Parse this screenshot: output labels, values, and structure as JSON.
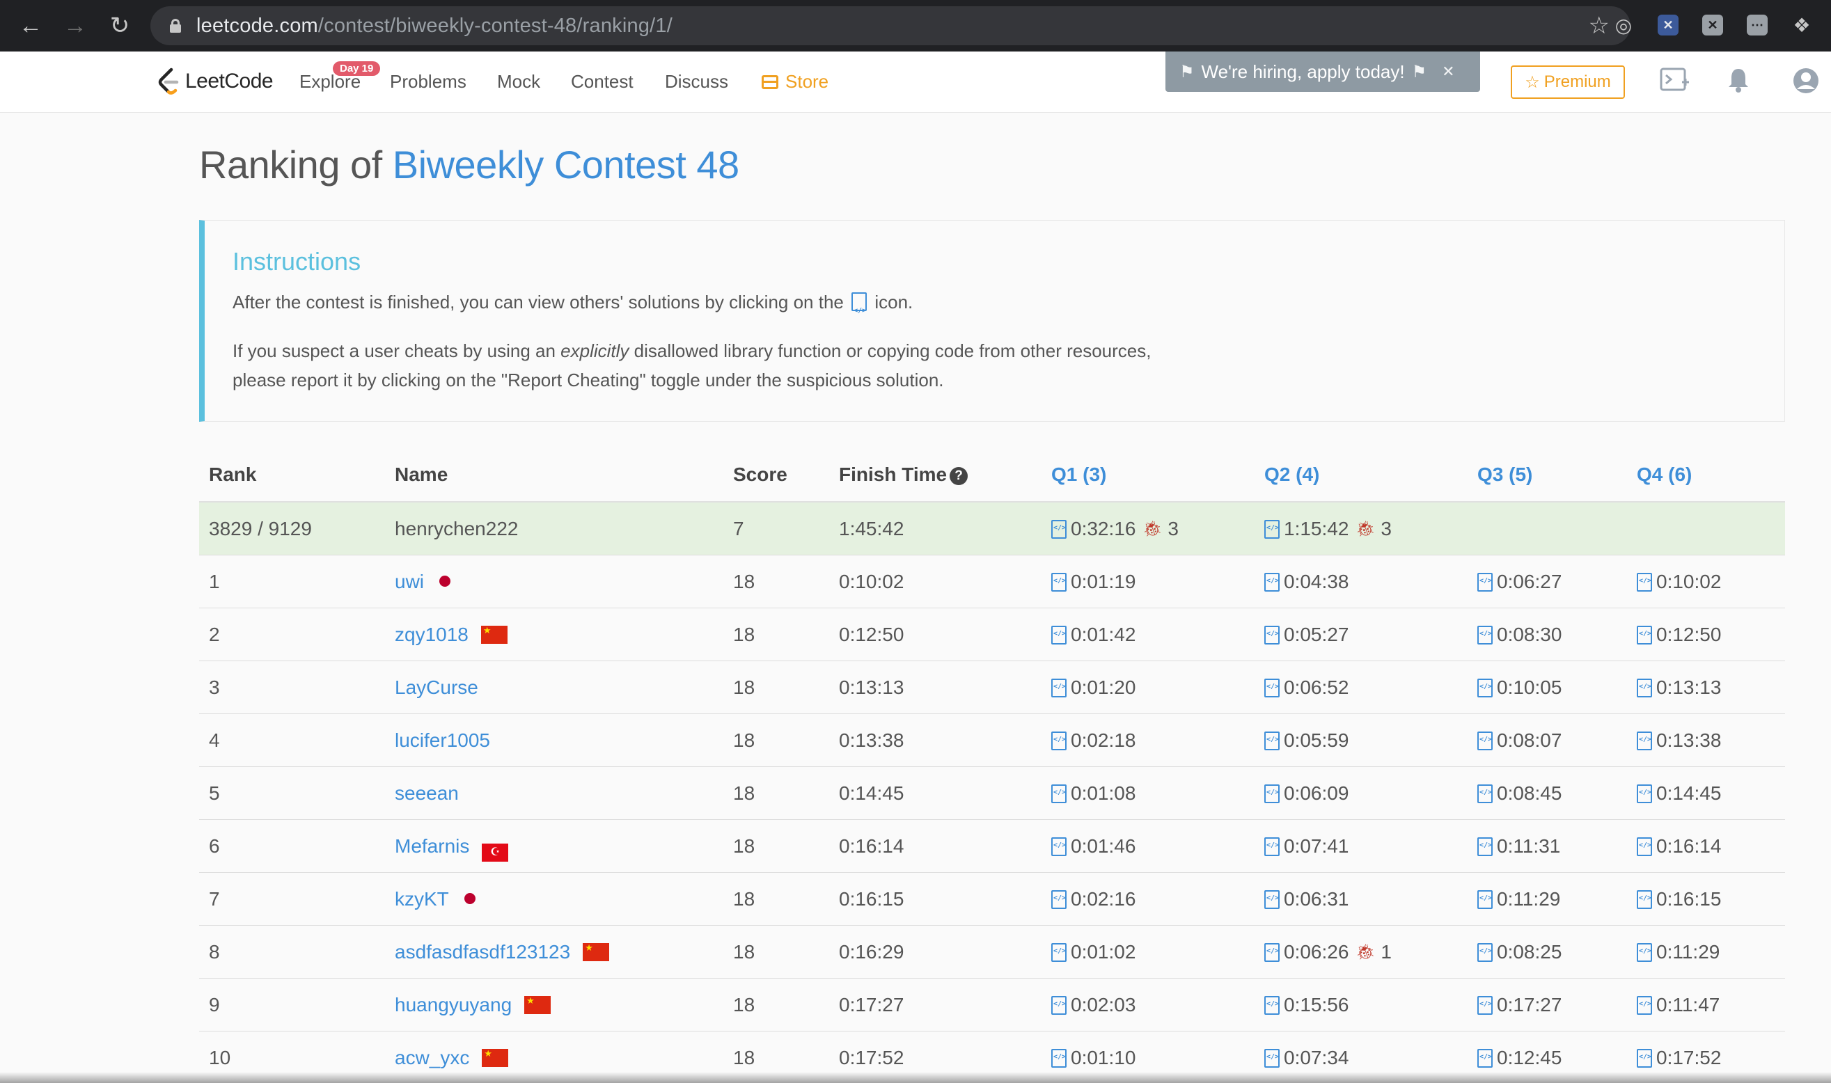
{
  "browser": {
    "url_host": "leetcode.com",
    "url_path": "/contest/biweekly-contest-48/ranking/1/"
  },
  "nav": {
    "logo_text": "LeetCode",
    "explore": "Explore",
    "explore_badge": "Day 19",
    "problems": "Problems",
    "mock": "Mock",
    "contest": "Contest",
    "discuss": "Discuss",
    "store": "Store",
    "hiring": "We're hiring, apply today!",
    "premium": "Premium"
  },
  "page": {
    "title_prefix": "Ranking of",
    "title_link": "Biweekly Contest 48"
  },
  "instructions": {
    "heading": "Instructions",
    "line1_before": "After the contest is finished, you can view others' solutions by clicking on the",
    "line1_after": "icon.",
    "line2_a": "If you suspect a user cheats by using an",
    "line2_em": "explicitly",
    "line2_b": "disallowed library function or copying code from other resources,",
    "line3": "please report it by clicking on the \"Report Cheating\" toggle under the suspicious solution."
  },
  "table": {
    "headers": {
      "rank": "Rank",
      "name": "Name",
      "score": "Score",
      "finish": "Finish Time",
      "q1": "Q1 (3)",
      "q2": "Q2 (4)",
      "q3": "Q3 (5)",
      "q4": "Q4 (6)"
    },
    "my_row": {
      "rank": "3829 / 9129",
      "name": "henrychen222",
      "score": "7",
      "finish": "1:45:42",
      "q1": "0:32:16",
      "q1_bugs": "3",
      "q2": "1:15:42",
      "q2_bugs": "3"
    },
    "rows": [
      {
        "rank": "1",
        "name": "uwi",
        "flag": "jp",
        "score": "18",
        "finish": "0:10:02",
        "q1": "0:01:19",
        "q2": "0:04:38",
        "q3": "0:06:27",
        "q4": "0:10:02"
      },
      {
        "rank": "2",
        "name": "zqy1018",
        "flag": "cn",
        "score": "18",
        "finish": "0:12:50",
        "q1": "0:01:42",
        "q2": "0:05:27",
        "q3": "0:08:30",
        "q4": "0:12:50"
      },
      {
        "rank": "3",
        "name": "LayCurse",
        "flag": "",
        "score": "18",
        "finish": "0:13:13",
        "q1": "0:01:20",
        "q2": "0:06:52",
        "q3": "0:10:05",
        "q4": "0:13:13"
      },
      {
        "rank": "4",
        "name": "lucifer1005",
        "flag": "",
        "score": "18",
        "finish": "0:13:38",
        "q1": "0:02:18",
        "q2": "0:05:59",
        "q3": "0:08:07",
        "q4": "0:13:38"
      },
      {
        "rank": "5",
        "name": "seeean",
        "flag": "",
        "score": "18",
        "finish": "0:14:45",
        "q1": "0:01:08",
        "q2": "0:06:09",
        "q3": "0:08:45",
        "q4": "0:14:45"
      },
      {
        "rank": "6",
        "name": "Mefarnis",
        "flag": "tr",
        "score": "18",
        "finish": "0:16:14",
        "q1": "0:01:46",
        "q2": "0:07:41",
        "q3": "0:11:31",
        "q4": "0:16:14"
      },
      {
        "rank": "7",
        "name": "kzyKT",
        "flag": "jp",
        "score": "18",
        "finish": "0:16:15",
        "q1": "0:02:16",
        "q2": "0:06:31",
        "q3": "0:11:29",
        "q4": "0:16:15"
      },
      {
        "rank": "8",
        "name": "asdfasdfasdf123123",
        "flag": "cn",
        "score": "18",
        "finish": "0:16:29",
        "q1": "0:01:02",
        "q2": "0:06:26",
        "q2_bugs": "1",
        "q3": "0:08:25",
        "q4": "0:11:29"
      },
      {
        "rank": "9",
        "name": "huangyuyang",
        "flag": "cn",
        "score": "18",
        "finish": "0:17:27",
        "q1": "0:02:03",
        "q2": "0:15:56",
        "q3": "0:17:27",
        "q4": "0:11:47"
      },
      {
        "rank": "10",
        "name": "acw_yxc",
        "flag": "cn",
        "score": "18",
        "finish": "0:17:52",
        "q1": "0:01:10",
        "q2": "0:07:34",
        "q3": "0:12:45",
        "q4": "0:17:52"
      }
    ]
  },
  "colors": {
    "link_blue": "#3e8ed8",
    "info_teal": "#5bc0de",
    "premium_orange": "#f0a020",
    "my_row_green": "#e5f1e0",
    "bug_red": "#c0392b"
  }
}
